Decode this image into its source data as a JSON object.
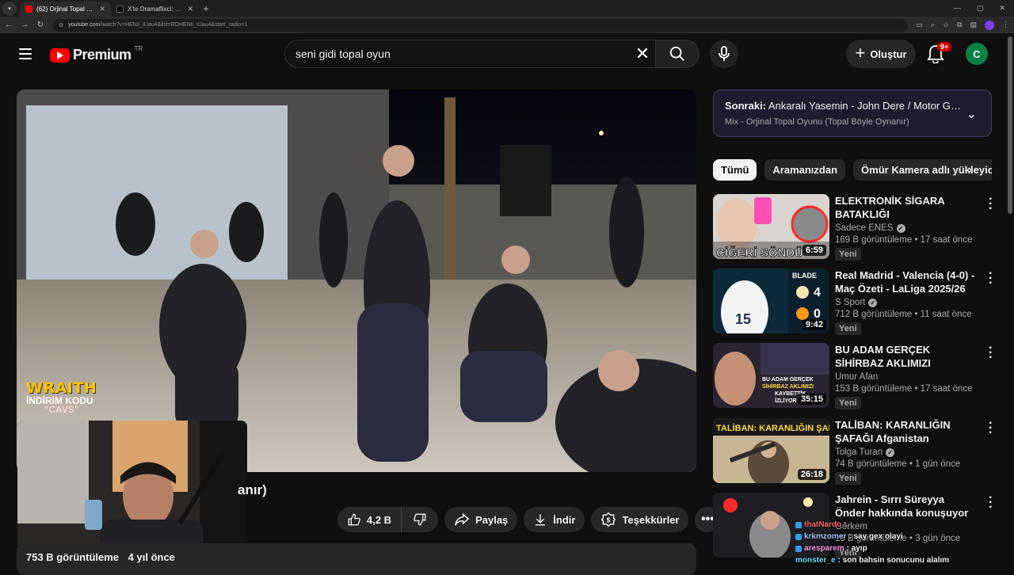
{
  "browser": {
    "tabs": [
      {
        "label": "(62) Orjinal Topal Oyunu (Topal Böyle Oynanır)",
        "active": true
      },
      {
        "label": "X'te Dramaflixci: \"🎯 Konsol Oyunu",
        "active": false
      }
    ],
    "url_host": "youtube.com",
    "url_path": "/watch?v=HENIi_iUau4&list=RDHENIi_iUau4&start_radio=1"
  },
  "header": {
    "brand": "Premium",
    "country": "TR",
    "search_value": "seni gidi topal oyun",
    "create_label": "Oluştur",
    "notifications": "9+",
    "user_initial": "C"
  },
  "player": {
    "promo_title": "WRAITH",
    "promo_line": "İNDİRİM KODU",
    "promo_code": "\"CAVS\"",
    "title_tail": "anır)"
  },
  "actions": {
    "likes": "4,2 B",
    "share": "Paylaş",
    "download": "İndir",
    "thanks": "Teşekkürler"
  },
  "description": {
    "views": "753 B görüntüleme",
    "age": "4 yıl önce"
  },
  "up_next": {
    "prefix": "Sonraki:",
    "title": "Ankaralı Yasemin - John Dere / Motor Geliyor",
    "subtitle": "Mix - Orjinal Topal Oyunu (Topal Böyle Oynanır)"
  },
  "chips": [
    "Tümü",
    "Aramanızdan",
    "Ömür Kamera adlı yükleyiciden"
  ],
  "recommendations": [
    {
      "title": "ELEKTRONİK SİGARA BATAKLIĞI",
      "channel": "Sadece ENES",
      "verified": true,
      "views": "169 B görüntüleme",
      "age": "17 saat önce",
      "badge": "Yeni",
      "duration": "6:59",
      "thumb_text": "CİĞERİ SÖNDÜ",
      "thumb_bg": "#d9d4cf"
    },
    {
      "title": "Real Madrid - Valencia (4-0) - Maç Özeti - LaLiga 2025/26",
      "channel": "S Sport",
      "verified": true,
      "views": "712 B görüntüleme",
      "age": "11 saat önce",
      "badge": "Yeni",
      "duration": "9:42",
      "thumb_text": "BLADE",
      "thumb_bg": "#0c2a3a",
      "score_home": "4",
      "score_away": "0"
    },
    {
      "title": "BU ADAM GERÇEK SİHİRBAZ AKLIMIZI KAYBETTİK ...",
      "channel": "Umur Afan",
      "verified": false,
      "views": "153 B görüntüleme",
      "age": "17 saat önce",
      "badge": "Yeni",
      "duration": "35:15",
      "thumb_text": "BU ADAM GERÇEK SİHİRBAZ AKLIMIZI KAYBETTİK İZLİYOR",
      "thumb_bg": "#2a2430"
    },
    {
      "title": "TALİBAN: KARANLIĞIN ŞAFAĞI Afganistan Belgeseli",
      "channel": "Tolga Turan",
      "verified": true,
      "views": "74 B görüntüleme",
      "age": "1 gün önce",
      "badge": "Yeni",
      "duration": "26:18",
      "thumb_text": "TALİBAN: KARANLIĞIN ŞAFAĞI",
      "thumb_bg": "#c8b692"
    },
    {
      "title": "Jahrein - Sırrı Süreyya Önder hakkında konuşuyor",
      "channel": "Görkem",
      "verified": false,
      "views": "15 B görüntüleme",
      "age": "3 gün önce",
      "badge": "Yeni",
      "duration": "",
      "thumb_text": "",
      "thumb_bg": "#1e1e22"
    }
  ],
  "chat": [
    {
      "user": "thatNardo",
      "msg": ":",
      "color": "u1"
    },
    {
      "user": "krkmzomer",
      "msg": ": say gex olayi",
      "color": "u2"
    },
    {
      "user": "aresparem",
      "msg": ": ayıp",
      "color": "u3"
    },
    {
      "user": "monster_e",
      "msg": ": son bahsin sonucunu alalım",
      "color": "u4"
    }
  ]
}
